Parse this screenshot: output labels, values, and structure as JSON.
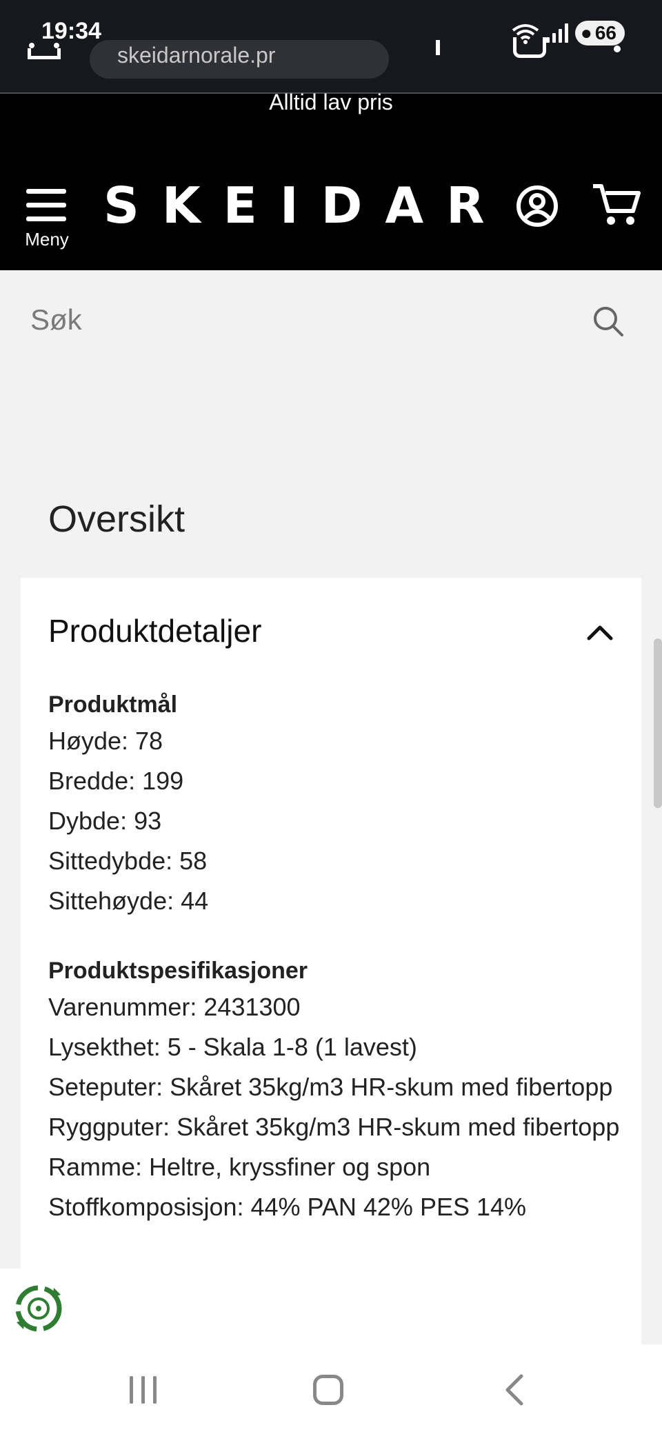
{
  "status_bar": {
    "time": "19:34",
    "battery": "66"
  },
  "browser": {
    "url_text": "skeidarnorale.pr"
  },
  "site": {
    "promo": "Alltid lav pris",
    "logo": "SKEIDAR",
    "menu_label": "Meny"
  },
  "search": {
    "placeholder": "Søk"
  },
  "overview": {
    "title": "Oversikt"
  },
  "product_details": {
    "title": "Produktdetaljer",
    "groups": [
      {
        "title": "Produktmål",
        "rows": [
          "Høyde: 78",
          "Bredde: 199",
          "Dybde: 93",
          "Sittedybde: 58",
          "Sittehøyde: 44"
        ]
      },
      {
        "title": "Produktspesifikasjoner",
        "rows": [
          "Varenummer: 2431300",
          "Lysekthet: 5 - Skala 1-8 (1 lavest)",
          "Seteputer: Skåret 35kg/m3 HR-skum med fibertopp",
          "Ryggputer: Skåret 35kg/m3 HR-skum med fibertopp",
          "Ramme: Heltre, kryssfiner og spon",
          "Stoffkomposisjon: 44% PAN 42% PES 14%"
        ]
      }
    ]
  },
  "icons": {
    "search": "search-icon",
    "account": "account-icon",
    "cart": "cart-icon",
    "menu": "hamburger-menu-icon",
    "collapse": "chevron-up-icon",
    "eco": "eco-recycle-icon"
  },
  "colors": {
    "header_bg": "#000000",
    "page_bg": "#f2f2f2",
    "eco_green": "#2e7d32"
  }
}
